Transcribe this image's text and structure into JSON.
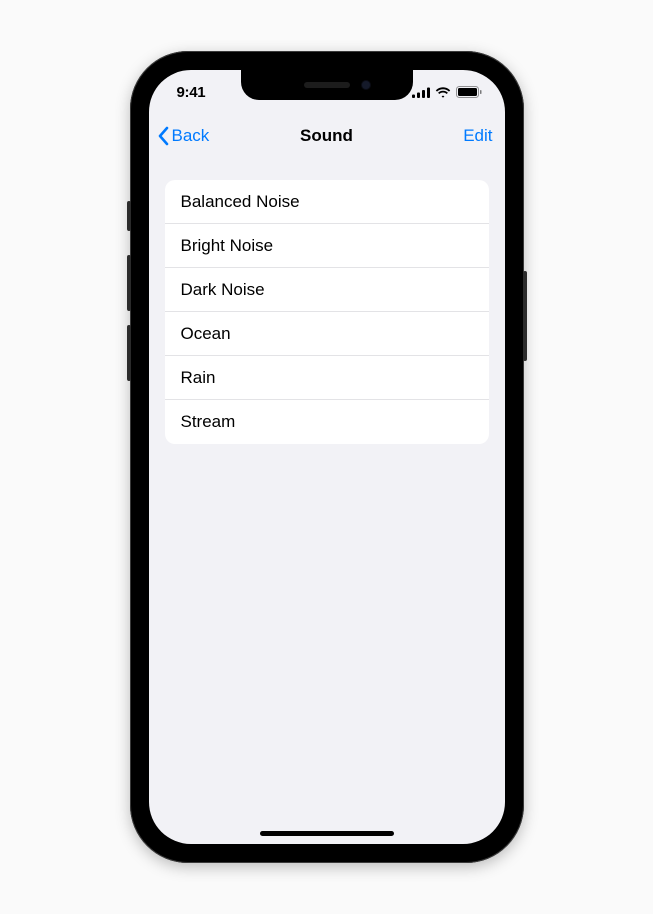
{
  "status": {
    "time": "9:41"
  },
  "nav": {
    "back_label": "Back",
    "title": "Sound",
    "edit_label": "Edit"
  },
  "sounds": {
    "items": [
      {
        "label": "Balanced Noise"
      },
      {
        "label": "Bright Noise"
      },
      {
        "label": "Dark Noise"
      },
      {
        "label": "Ocean"
      },
      {
        "label": "Rain"
      },
      {
        "label": "Stream"
      }
    ]
  }
}
